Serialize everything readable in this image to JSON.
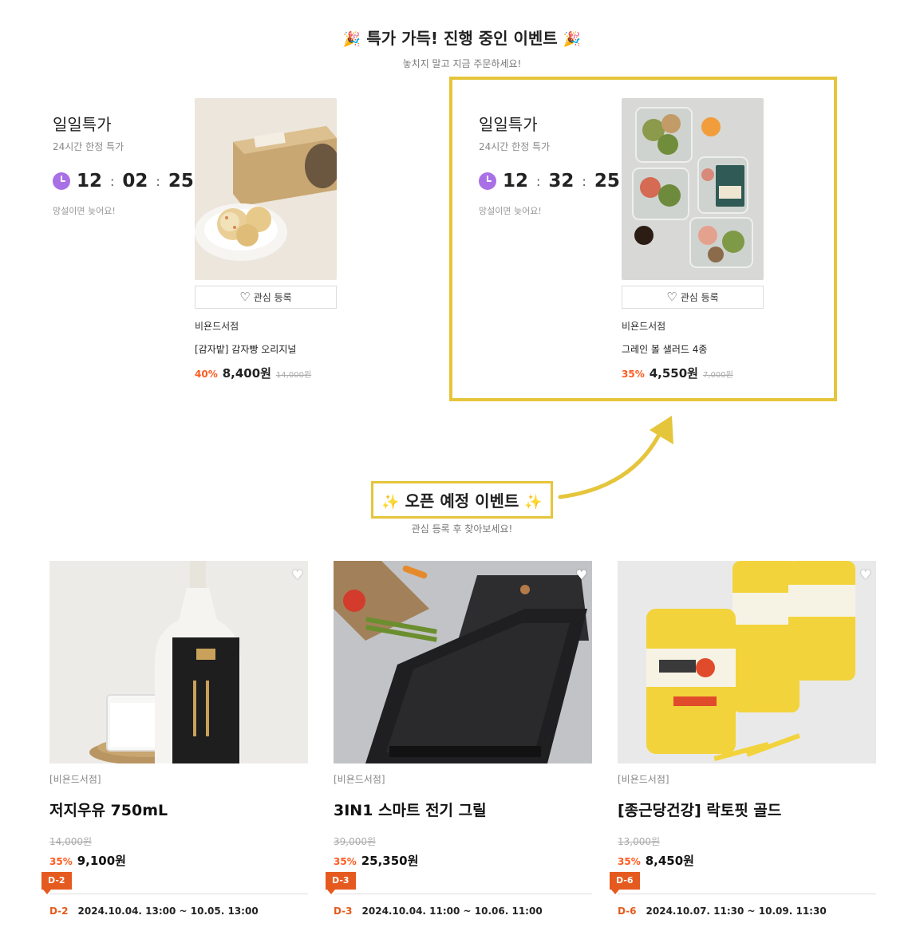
{
  "header": {
    "emoji_left": "🎉",
    "title": "특가 가득! 진행 중인 이벤트",
    "emoji_right": "🎉",
    "subtitle": "놓치지 말고 지금 주문하세요!"
  },
  "daily_deals": [
    {
      "title": "일일특가",
      "subtitle": "24시간 한정 특가",
      "timer": {
        "h": "12",
        "m": "02",
        "s": "25"
      },
      "note": "망설이면 늦어요!",
      "wish_label": "관심 등록",
      "seller": "비욘드서점",
      "name": "[감자밭] 감자빵 오리지널",
      "discount": "40%",
      "price": "8,400원",
      "original": "14,000원"
    },
    {
      "title": "일일특가",
      "subtitle": "24시간 한정 특가",
      "timer": {
        "h": "12",
        "m": "32",
        "s": "25"
      },
      "note": "망설이면 늦어요!",
      "wish_label": "관심 등록",
      "seller": "비욘드서점",
      "name": "그레인 볼 샐러드 4종",
      "discount": "35%",
      "price": "4,550원",
      "original": "7,000원"
    }
  ],
  "upcoming": {
    "emoji_left": "✨",
    "title": "오픈 예정 이벤트",
    "emoji_right": "✨",
    "subtitle": "관심 등록 후 찾아보세요!"
  },
  "cards": [
    {
      "seller": "[비욘드서점]",
      "name": "저지우유 750mL",
      "original": "14,000원",
      "discount": "35%",
      "price": "9,100원",
      "badge": "D-2",
      "date_d": "D-2",
      "date_range": "2024.10.04. 13:00 ~ 10.05. 13:00"
    },
    {
      "seller": "[비욘드서점]",
      "name": "3IN1 스마트 전기 그릴",
      "original": "39,000원",
      "discount": "35%",
      "price": "25,350원",
      "badge": "D-3",
      "date_d": "D-3",
      "date_range": "2024.10.04. 11:00 ~ 10.06. 11:00"
    },
    {
      "seller": "[비욘드서점]",
      "name": "[종근당건강] 락토핏 골드",
      "original": "13,000원",
      "discount": "35%",
      "price": "8,450원",
      "badge": "D-6",
      "date_d": "D-6",
      "date_range": "2024.10.07. 11:30 ~ 10.09. 11:30"
    }
  ],
  "colors": {
    "accent_discount": "#ff5a1f",
    "highlight": "#e5c53b",
    "clock": "#a970e6",
    "badge": "#e55a1e"
  }
}
